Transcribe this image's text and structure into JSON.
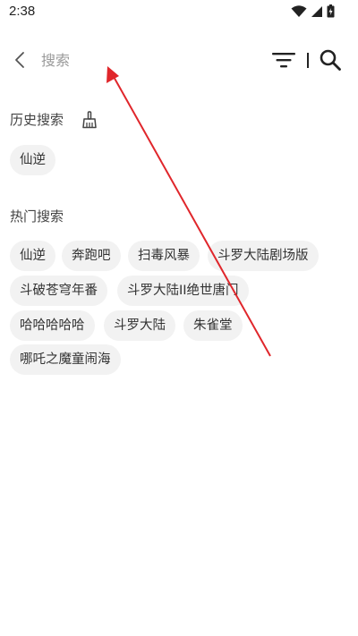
{
  "status_bar": {
    "time": "2:38",
    "icons": [
      "wifi-icon",
      "cellular-signal-icon",
      "battery-charging-icon"
    ]
  },
  "search": {
    "placeholder": "搜索",
    "value": "",
    "icons": [
      "back-icon",
      "filter-icon",
      "search-icon"
    ]
  },
  "history": {
    "title": "历史搜索",
    "clear_icon": "broom-icon",
    "items": [
      "仙逆"
    ]
  },
  "hot": {
    "title": "热门搜索",
    "items": [
      "仙逆",
      "奔跑吧",
      "扫毒风暴",
      "斗罗大陆剧场版",
      "斗破苍穹年番",
      "斗罗大陆II绝世唐门",
      "哈哈哈哈哈",
      "斗罗大陆",
      "朱雀堂",
      "哪吒之魔童闹海"
    ]
  },
  "colors": {
    "chip_background": "#f2f2f2",
    "annotation_arrow": "#e0262b",
    "text_primary": "#333333",
    "placeholder": "#9a9a9a"
  }
}
